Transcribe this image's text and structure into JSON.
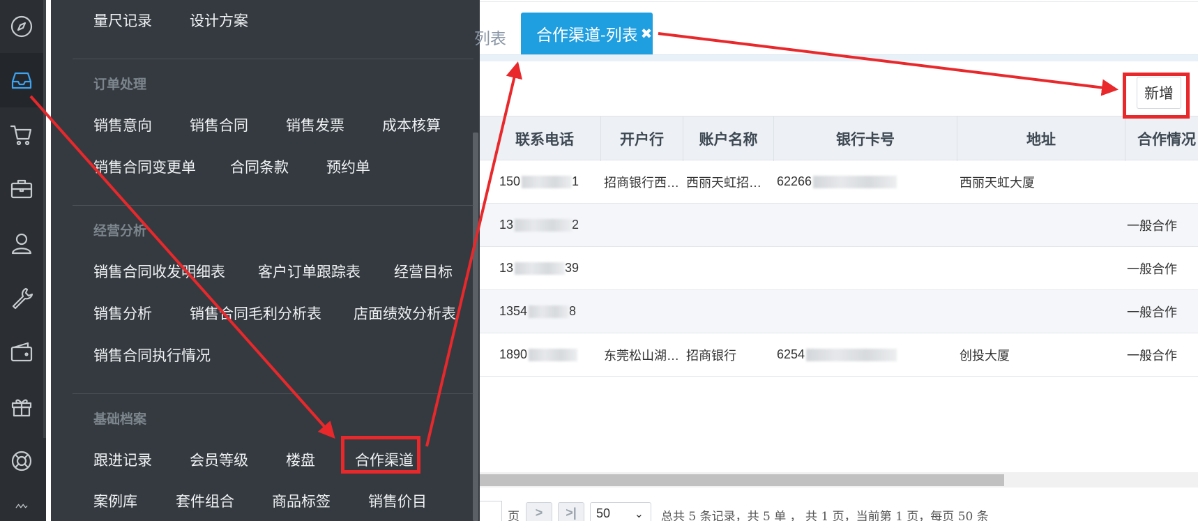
{
  "flyout": {
    "row_top": [
      "量尺记录",
      "设计方案"
    ],
    "sections": [
      {
        "title": "订单处理",
        "rows": [
          [
            "销售意向",
            "销售合同",
            "销售发票",
            "成本核算"
          ],
          [
            "销售合同变更单",
            "合同条款",
            "预约单"
          ]
        ]
      },
      {
        "title": "经营分析",
        "rows": [
          [
            "销售合同收发明细表",
            "客户订单跟踪表",
            "经营目标"
          ],
          [
            "销售分析",
            "销售合同毛利分析表",
            "店面绩效分析表"
          ],
          [
            "销售合同执行情况"
          ]
        ]
      },
      {
        "title": "基础档案",
        "rows": [
          [
            "跟进记录",
            "会员等级",
            "楼盘",
            "合作渠道"
          ],
          [
            "案例库",
            "套件组合",
            "商品标签",
            "销售价目"
          ]
        ]
      }
    ]
  },
  "tabs": {
    "prev_label_tail": "列表",
    "active_label": "合作渠道-列表",
    "close_glyph": "✖"
  },
  "toolbar": {
    "add_label": "新增"
  },
  "table": {
    "columns": [
      "联系电话",
      "开户行",
      "账户名称",
      "银行卡号",
      "地址",
      "合作情况"
    ],
    "rows": [
      {
        "phone_prefix": "150",
        "phone_suffix": "1",
        "bank": "招商银行西…",
        "account_name": "西丽天虹招…",
        "card_prefix": "62266",
        "address": "西丽天虹大厦",
        "status": ""
      },
      {
        "phone_prefix": "13",
        "phone_suffix": "2",
        "bank": "",
        "account_name": "",
        "card_prefix": "",
        "address": "",
        "status": "一般合作"
      },
      {
        "phone_prefix": "13",
        "phone_suffix": "39",
        "bank": "",
        "account_name": "",
        "card_prefix": "",
        "address": "",
        "status": "一般合作"
      },
      {
        "phone_prefix": "1354",
        "phone_suffix": "8",
        "bank": "",
        "account_name": "",
        "card_prefix": "",
        "address": "",
        "status": "一般合作"
      },
      {
        "phone_prefix": "1890",
        "phone_suffix": "",
        "bank": "东莞松山湖…",
        "account_name": "招商银行",
        "card_prefix": "6254",
        "address": "创投大厦",
        "status": "一般合作"
      }
    ]
  },
  "pager": {
    "page_unit": "页",
    "next_glyph": ">",
    "last_glyph": ">|",
    "page_size": "50",
    "summary": "总共 5 条记录，共 5 单 ， 共 1 页，当前第 1 页，每页 50 条"
  },
  "rail": {
    "icons": [
      "compass-icon",
      "inbox-icon",
      "cart-icon",
      "briefcase-icon",
      "user-icon",
      "wrench-icon",
      "wallet-icon",
      "gift-icon",
      "lifebuoy-icon",
      "wave-icon"
    ],
    "active_index": 1
  },
  "annotation_color": "#e8282b"
}
